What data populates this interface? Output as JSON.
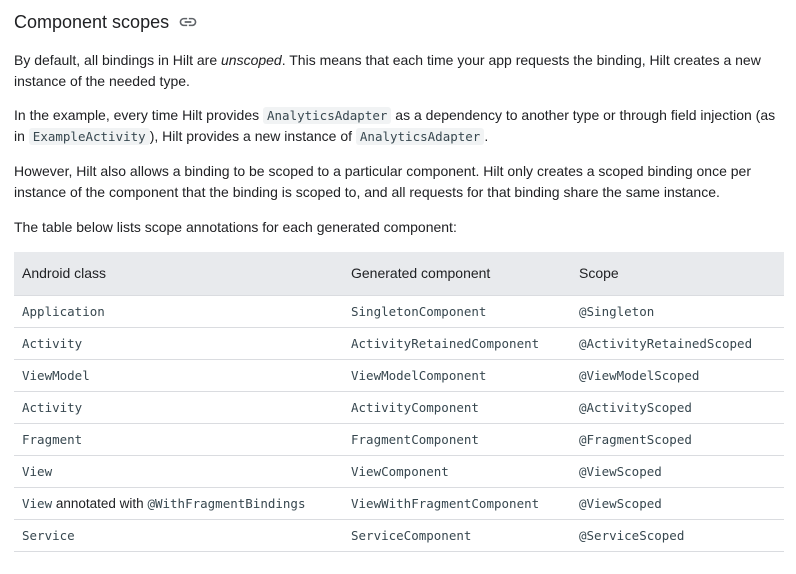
{
  "section": {
    "title": "Component scopes",
    "link_icon": "link-icon"
  },
  "paragraphs": {
    "p1_before": "By default, all bindings in Hilt are ",
    "p1_em": "unscoped",
    "p1_after": ". This means that each time your app requests the binding, Hilt creates a new instance of the needed type.",
    "p2_a": "In the example, every time Hilt provides ",
    "p2_code1": "AnalyticsAdapter",
    "p2_b": " as a dependency to another type or through field injection (as in ",
    "p2_code2": "ExampleActivity",
    "p2_c": "), Hilt provides a new instance of ",
    "p2_code3": "AnalyticsAdapter",
    "p2_d": ".",
    "p3": "However, Hilt also allows a binding to be scoped to a particular component. Hilt only creates a scoped binding once per instance of the component that the binding is scoped to, and all requests for that binding share the same instance.",
    "p4": "The table below lists scope annotations for each generated component:"
  },
  "table": {
    "headers": [
      "Android class",
      "Generated component",
      "Scope"
    ],
    "rows": [
      {
        "android_class": "Application",
        "component": "SingletonComponent",
        "scope": "@Singleton"
      },
      {
        "android_class": "Activity",
        "component": "ActivityRetainedComponent",
        "scope": "@ActivityRetainedScoped"
      },
      {
        "android_class": "ViewModel",
        "component": "ViewModelComponent",
        "scope": "@ViewModelScoped"
      },
      {
        "android_class": "Activity",
        "component": "ActivityComponent",
        "scope": "@ActivityScoped"
      },
      {
        "android_class": "Fragment",
        "component": "FragmentComponent",
        "scope": "@FragmentScoped"
      },
      {
        "android_class": "View",
        "component": "ViewComponent",
        "scope": "@ViewScoped"
      },
      {
        "android_class_code": "View",
        "android_class_text": " annotated with ",
        "android_class_code2": "@WithFragmentBindings",
        "component": "ViewWithFragmentComponent",
        "scope": "@ViewScoped"
      },
      {
        "android_class": "Service",
        "component": "ServiceComponent",
        "scope": "@ServiceScoped"
      }
    ]
  }
}
